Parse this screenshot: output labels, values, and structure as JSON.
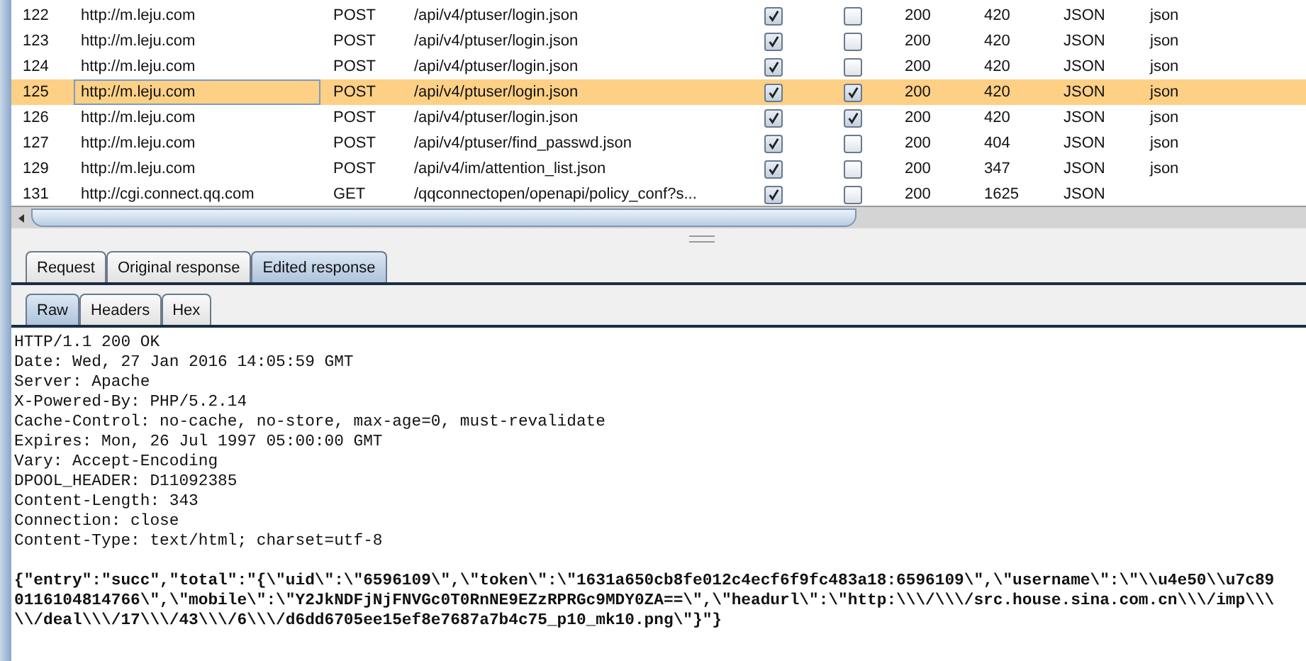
{
  "table": {
    "rows": [
      {
        "number": "122",
        "host": "http://m.leju.com",
        "method": "POST",
        "url": "/api/v4/ptuser/login.json",
        "check_1": true,
        "check_2": false,
        "status": "200",
        "length": "420",
        "mime": "JSON",
        "extension": "json",
        "selected": false
      },
      {
        "number": "123",
        "host": "http://m.leju.com",
        "method": "POST",
        "url": "/api/v4/ptuser/login.json",
        "check_1": true,
        "check_2": false,
        "status": "200",
        "length": "420",
        "mime": "JSON",
        "extension": "json",
        "selected": false
      },
      {
        "number": "124",
        "host": "http://m.leju.com",
        "method": "POST",
        "url": "/api/v4/ptuser/login.json",
        "check_1": true,
        "check_2": false,
        "status": "200",
        "length": "420",
        "mime": "JSON",
        "extension": "json",
        "selected": false
      },
      {
        "number": "125",
        "host": "http://m.leju.com",
        "method": "POST",
        "url": "/api/v4/ptuser/login.json",
        "check_1": true,
        "check_2": true,
        "status": "200",
        "length": "420",
        "mime": "JSON",
        "extension": "json",
        "selected": true
      },
      {
        "number": "126",
        "host": "http://m.leju.com",
        "method": "POST",
        "url": "/api/v4/ptuser/login.json",
        "check_1": true,
        "check_2": true,
        "status": "200",
        "length": "420",
        "mime": "JSON",
        "extension": "json",
        "selected": false
      },
      {
        "number": "127",
        "host": "http://m.leju.com",
        "method": "POST",
        "url": "/api/v4/ptuser/find_passwd.json",
        "check_1": true,
        "check_2": false,
        "status": "200",
        "length": "404",
        "mime": "JSON",
        "extension": "json",
        "selected": false
      },
      {
        "number": "129",
        "host": "http://m.leju.com",
        "method": "POST",
        "url": "/api/v4/im/attention_list.json",
        "check_1": true,
        "check_2": false,
        "status": "200",
        "length": "347",
        "mime": "JSON",
        "extension": "json",
        "selected": false
      },
      {
        "number": "131",
        "host": "http://cgi.connect.qq.com",
        "method": "GET",
        "url": "/qqconnectopen/openapi/policy_conf?s...",
        "check_1": true,
        "check_2": false,
        "status": "200",
        "length": "1625",
        "mime": "JSON",
        "extension": "",
        "selected": false
      }
    ]
  },
  "tabs": [
    {
      "label": "Request",
      "selected": false
    },
    {
      "label": "Original response",
      "selected": false
    },
    {
      "label": "Edited response",
      "selected": true
    }
  ],
  "view_tabs": [
    {
      "label": "Raw",
      "selected": true
    },
    {
      "label": "Headers",
      "selected": false
    },
    {
      "label": "Hex",
      "selected": false
    }
  ],
  "headers": [
    "HTTP/1.1 200 OK",
    "Date: Wed, 27 Jan 2016 14:05:59 GMT",
    "Server: Apache",
    "X-Powered-By: PHP/5.2.14",
    "Cache-Control: no-cache, no-store, max-age=0, must-revalidate",
    "Expires: Mon, 26 Jul 1997 05:00:00 GMT",
    "Vary: Accept-Encoding",
    "DPOOL_HEADER: D11092385",
    "Content-Length: 343",
    "Connection: close",
    "Content-Type: text/html; charset=utf-8"
  ],
  "body": [
    "{\"entry\":\"succ\",\"total\":\"{\\\"uid\\\":\\\"6596109\\\",\\\"token\\\":\\\"1631a650cb8fe012c4ecf6f9fc483a18:6596109\\\",\\\"username\\\":\\\"\\\\u4e50\\\\u7c89",
    "0116104814766\\\",\\\"mobile\\\":\\\"Y2JkNDFjNjFNVGc0T0RnNE9EZzRPRGc9MDY0ZA==\\\",\\\"headurl\\\":\\\"http:\\\\\\/\\\\\\/src.house.sina.com.cn\\\\\\/imp\\\\\\",
    "\\\\/deal\\\\\\/17\\\\\\/43\\\\\\/6\\\\\\/d6dd6705ee15ef8e7687a7b4c75_p10_mk10.png\\\"}\"}"
  ]
}
